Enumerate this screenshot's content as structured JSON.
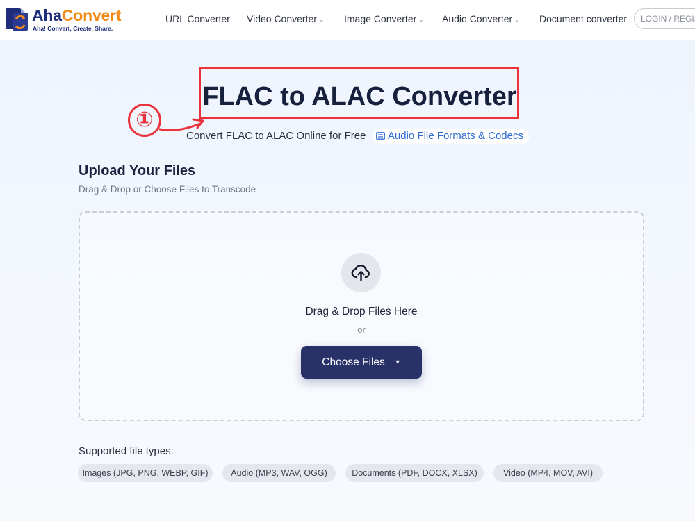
{
  "brand": {
    "name_part1": "Aha",
    "name_part2": "Convert",
    "tagline": "Aha! Convert, Create, Share.",
    "colors": {
      "primary": "#1f2d7a",
      "accent": "#f18a16"
    }
  },
  "nav": {
    "items": [
      {
        "label": "URL Converter",
        "dropdown": false
      },
      {
        "label": "Video Converter",
        "dropdown": true
      },
      {
        "label": "Image Converter",
        "dropdown": true
      },
      {
        "label": "Audio Converter",
        "dropdown": true
      },
      {
        "label": "Document converter",
        "dropdown": false
      }
    ],
    "login_label": "LOGIN / REGISTER",
    "dropdown_icon": "chevron-down-icon"
  },
  "hero": {
    "title": "FLAC to ALAC Converter",
    "subtitle": "Convert FLAC to ALAC Online for Free",
    "formats_link": "Audio File Formats & Codecs",
    "annotation_marker": "①",
    "annotation_color": "#e9323a"
  },
  "upload": {
    "title": "Upload Your Files",
    "subtitle": "Drag & Drop or Choose Files to Transcode",
    "drop_text": "Drag & Drop Files Here",
    "or_text": "or",
    "choose_button": "Choose Files",
    "upload_icon": "cloud-upload-icon",
    "button_color": "#283168"
  },
  "supported": {
    "label": "Supported file types:",
    "types": [
      "Images (JPG, PNG, WEBP, GIF)",
      "Audio (MP3, WAV, OGG)",
      "Documents (PDF, DOCX, XLSX)",
      "Video (MP4, MOV, AVI)"
    ]
  }
}
